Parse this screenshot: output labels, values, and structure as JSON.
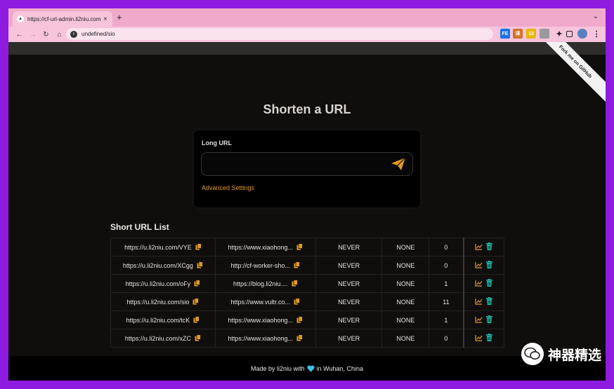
{
  "browser": {
    "tab_title": "https://cf-url-admin.li2niu.com",
    "tab_close": "×",
    "new_tab": "+",
    "tab_menu": "⌄",
    "address": "undefined/sio",
    "extensions": [
      {
        "name": "fe-extension-icon",
        "label": "FE",
        "color": "#1a73e8"
      },
      {
        "name": "translate-extension-icon",
        "label": "译",
        "color": "#d0742a"
      },
      {
        "name": "badge-extension-icon",
        "label": "12",
        "color": "#e6b800"
      },
      {
        "name": "gray-extension-icon",
        "label": "",
        "color": "#9a9a9a"
      }
    ]
  },
  "page": {
    "ribbon": "Fork me on GitHub",
    "heading": "Shorten a URL",
    "form": {
      "label": "Long URL",
      "input_value": "",
      "input_placeholder": "",
      "advanced": "Advanced Settings"
    },
    "list_title": "Short URL List",
    "rows": [
      {
        "short": "https://u.li2niu.com/VYE",
        "long": "https://www.xiaohong...",
        "expire": "NEVER",
        "password": "NONE",
        "count": "0"
      },
      {
        "short": "https://u.li2niu.com/XCgg",
        "long": "http://cf-worker-sho...",
        "expire": "NEVER",
        "password": "NONE",
        "count": "0"
      },
      {
        "short": "https://u.li2niu.com/oFy",
        "long": "https://blog.li2niu....",
        "expire": "NEVER",
        "password": "NONE",
        "count": "1"
      },
      {
        "short": "https://u.li2niu.com/sio",
        "long": "https://www.vultr.co...",
        "expire": "NEVER",
        "password": "NONE",
        "count": "11"
      },
      {
        "short": "https://u.li2niu.com/tcK",
        "long": "https://www.xiaohong...",
        "expire": "NEVER",
        "password": "NONE",
        "count": "1"
      },
      {
        "short": "https://u.li2niu.com/xZC",
        "long": "https://www.xiaohong...",
        "expire": "NEVER",
        "password": "NONE",
        "count": "0"
      }
    ],
    "footer": {
      "before": "Made by li2niu with",
      "after": "in Wuhan, China"
    }
  },
  "watermark": "神器精选",
  "colors": {
    "accent": "#e29a22",
    "teal": "#19c2b0",
    "heart": "#3fc1e6",
    "frame": "#8f1be0",
    "tab_strip": "#f0a9cb"
  },
  "icons": [
    "paper-plane-icon",
    "copy-icon",
    "chart-icon",
    "trash-icon",
    "heart-icon",
    "wechat-icon"
  ]
}
